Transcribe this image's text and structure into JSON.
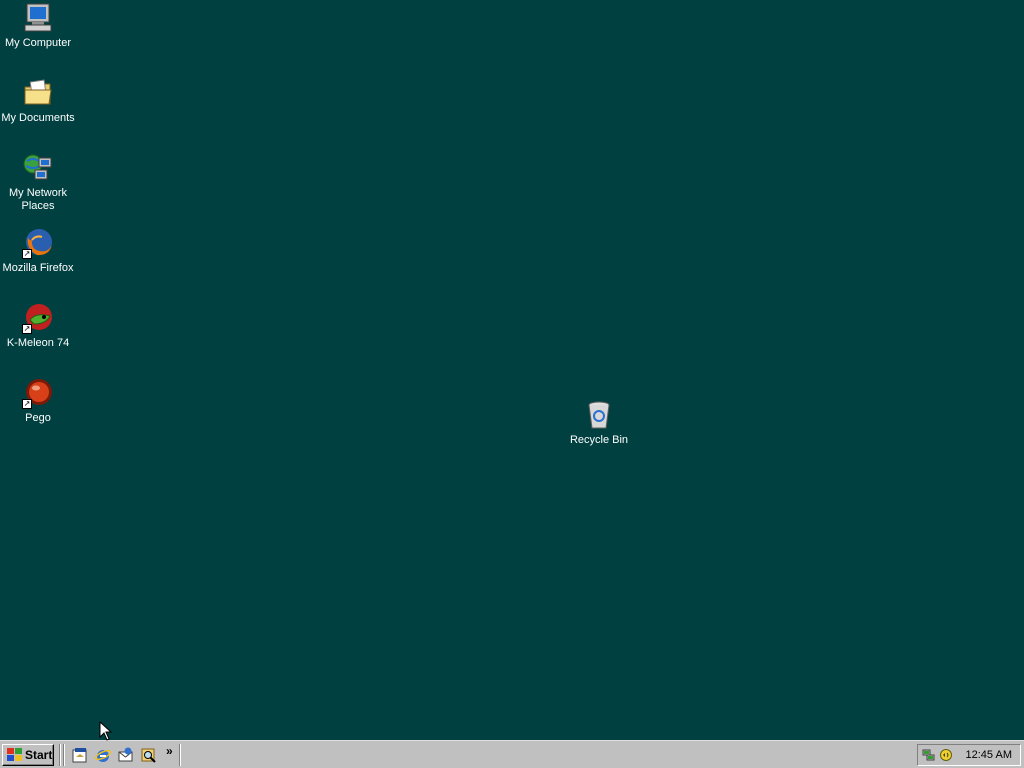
{
  "desktop": {
    "background": "#014040",
    "icons": [
      {
        "label": "My Computer",
        "icon": "computer-icon"
      },
      {
        "label": "My Documents",
        "icon": "folder-documents-icon"
      },
      {
        "label": "My Network Places",
        "icon": "network-places-icon"
      },
      {
        "label": "Mozilla Firefox",
        "icon": "firefox-icon",
        "shortcut": true
      },
      {
        "label": "K-Meleon 74",
        "icon": "kmeleon-icon",
        "shortcut": true
      },
      {
        "label": "Pego",
        "icon": "pego-icon",
        "shortcut": true
      },
      {
        "label": "Recycle Bin",
        "icon": "recycle-bin-icon"
      }
    ]
  },
  "taskbar": {
    "start_label": "Start",
    "quick_launch": [
      {
        "icon": "show-desktop-icon"
      },
      {
        "icon": "internet-explorer-icon"
      },
      {
        "icon": "outlook-express-icon"
      },
      {
        "icon": "search-icon"
      }
    ],
    "chevron": "»",
    "tray": {
      "icons": [
        "network-tray-icon",
        "volume-tray-icon"
      ],
      "clock": "12:45 AM"
    }
  }
}
